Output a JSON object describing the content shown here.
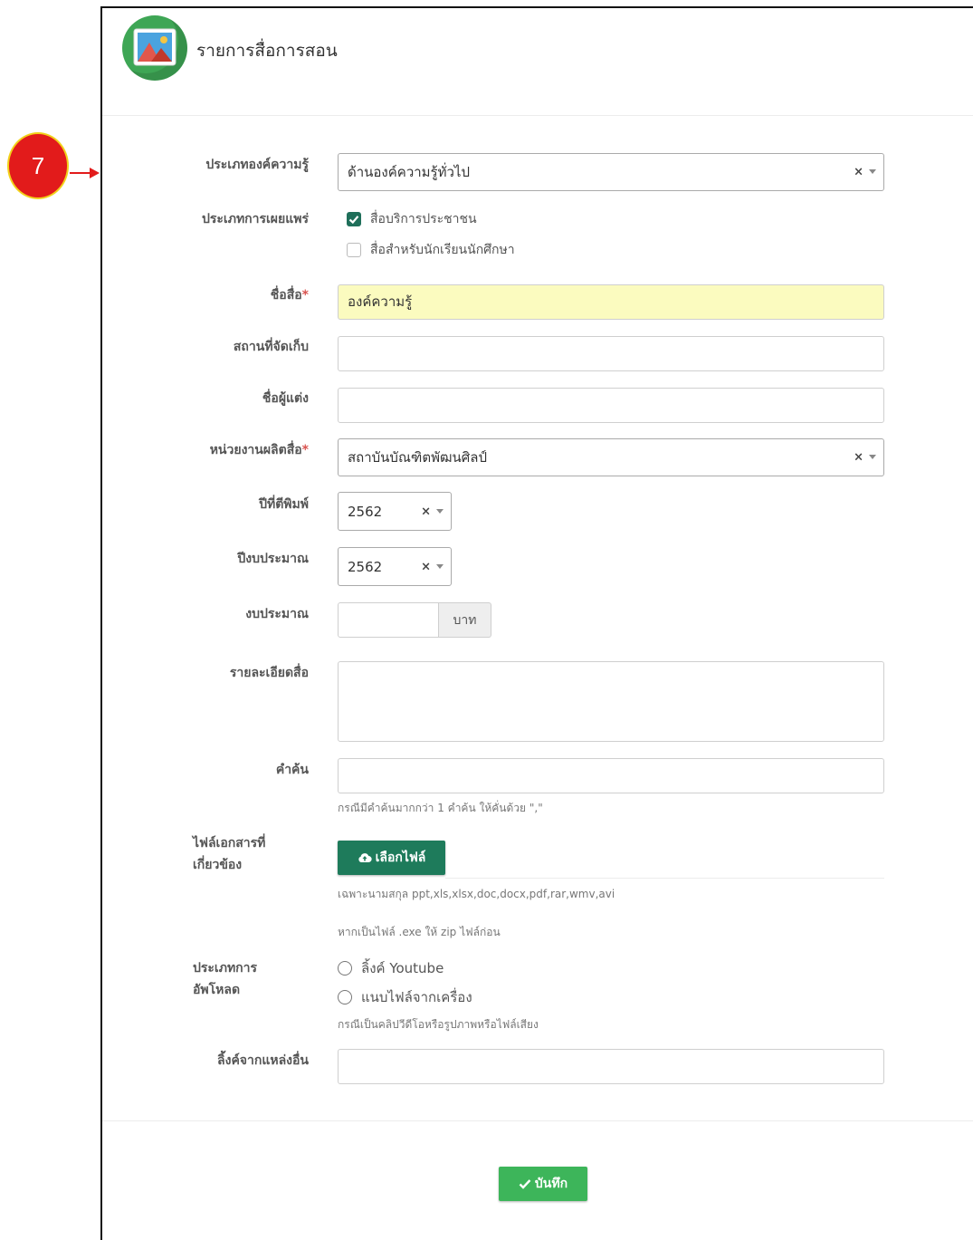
{
  "header": {
    "title": "รายการสื่อการสอน",
    "icon": "image-icon"
  },
  "annotation": {
    "number": "7",
    "color": "#e21b1b"
  },
  "form": {
    "knowledge_type": {
      "label": "ประเภทองค์ความรู้",
      "value": "ด้านองค์ความรู้ทั่วไป"
    },
    "publish_type": {
      "label": "ประเภทการเผยแพร่",
      "options": [
        {
          "label": "สื่อบริการประชาชน",
          "checked": true
        },
        {
          "label": "สื่อสำหรับนักเรียนนักศึกษา",
          "checked": false
        }
      ]
    },
    "media_name": {
      "label": "ชื่อสื่อ",
      "required": "*",
      "value": "องค์ความรู้"
    },
    "storage_location": {
      "label": "สถานที่จัดเก็บ",
      "value": ""
    },
    "author": {
      "label": "ชื่อผู้แต่ง",
      "value": ""
    },
    "producer": {
      "label": "หน่วยงานผลิตสื่อ",
      "required": "*",
      "value": "สถาบันบัณฑิตพัฒนศิลป์"
    },
    "publish_year": {
      "label": "ปีที่ตีพิมพ์",
      "value": "2562"
    },
    "budget_year": {
      "label": "ปีงบประมาณ",
      "value": "2562"
    },
    "budget": {
      "label": "งบประมาณ",
      "value": "",
      "unit": "บาท"
    },
    "details": {
      "label": "รายละเอียดสื่อ",
      "value": ""
    },
    "keywords": {
      "label": "คำค้น",
      "value": "",
      "help": "กรณีมีคำค้นมากกว่า 1 คำค้น ให้คั่นด้วย \",\""
    },
    "documents": {
      "label_line1": "ไฟล์เอกสารที่",
      "label_line2": "เกี่ยวข้อง",
      "button": "เลือกไฟล์",
      "help1": "เฉพาะนามสกุล ppt,xls,xlsx,doc,docx,pdf,rar,wmv,avi",
      "help2": "หากเป็นไฟล์ .exe ให้ zip ไฟล์ก่อน"
    },
    "upload_type": {
      "label_line1": "ประเภทการ",
      "label_line2": "อัพโหลด",
      "options": [
        "ลิ้งค์ Youtube",
        "แนบไฟล์จากเครื่อง"
      ],
      "help": "กรณีเป็นคลิปวีดีโอหรือรูปภาพหรือไฟล์เสียง"
    },
    "external_link": {
      "label": "ลิ้งค์จากแหล่งอื่น",
      "value": ""
    }
  },
  "actions": {
    "save": "บันทึก"
  }
}
